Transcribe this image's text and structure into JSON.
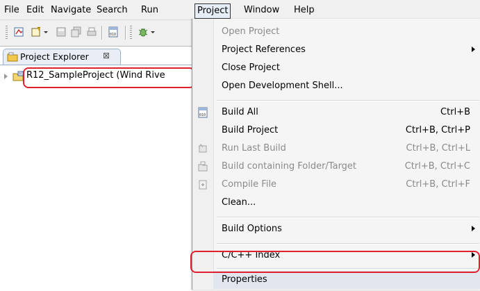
{
  "menubar": {
    "items": [
      "File",
      "Edit",
      "Navigate",
      "Search",
      "Run",
      "Project",
      "Window",
      "Help"
    ],
    "active": "Project"
  },
  "explorer": {
    "tab_label": "Project Explorer",
    "close_glyph": "⊠",
    "tree": [
      {
        "label": "R12_SampleProject (Wind Rive",
        "expanded": false
      }
    ]
  },
  "project_menu": {
    "items": [
      {
        "label": "Open Project",
        "shortcut": "",
        "enabled": false,
        "submenu": false
      },
      {
        "label": "Project References",
        "shortcut": "",
        "enabled": true,
        "submenu": true
      },
      {
        "label": "Close Project",
        "shortcut": "",
        "enabled": true,
        "submenu": false
      },
      {
        "label": "Open Development Shell...",
        "shortcut": "",
        "enabled": true,
        "submenu": false
      },
      {
        "label": "Build All",
        "shortcut": "Ctrl+B",
        "enabled": true,
        "submenu": false,
        "icon": "build-all-icon"
      },
      {
        "label": "Build Project",
        "shortcut": "Ctrl+B, Ctrl+P",
        "enabled": true,
        "submenu": false
      },
      {
        "label": "Run Last Build",
        "shortcut": "Ctrl+B, Ctrl+L",
        "enabled": false,
        "submenu": false,
        "icon": "run-last-build-icon"
      },
      {
        "label": "Build containing Folder/Target",
        "shortcut": "Ctrl+B, Ctrl+C",
        "enabled": false,
        "submenu": false,
        "icon": "build-folder-icon"
      },
      {
        "label": "Compile File",
        "shortcut": "Ctrl+B, Ctrl+F",
        "enabled": false,
        "submenu": false,
        "icon": "compile-file-icon"
      },
      {
        "label": "Clean...",
        "shortcut": "",
        "enabled": true,
        "submenu": false
      },
      {
        "label": "Build Options",
        "shortcut": "",
        "enabled": true,
        "submenu": true
      },
      {
        "label": "C/C++ Index",
        "shortcut": "",
        "enabled": true,
        "submenu": true
      },
      {
        "label": "Properties",
        "shortcut": "",
        "enabled": true,
        "submenu": false
      }
    ]
  },
  "colors": {
    "highlight_border": "#e0202f",
    "menu_background": "#f5f5f5",
    "disabled_text": "#8a8a8a"
  }
}
